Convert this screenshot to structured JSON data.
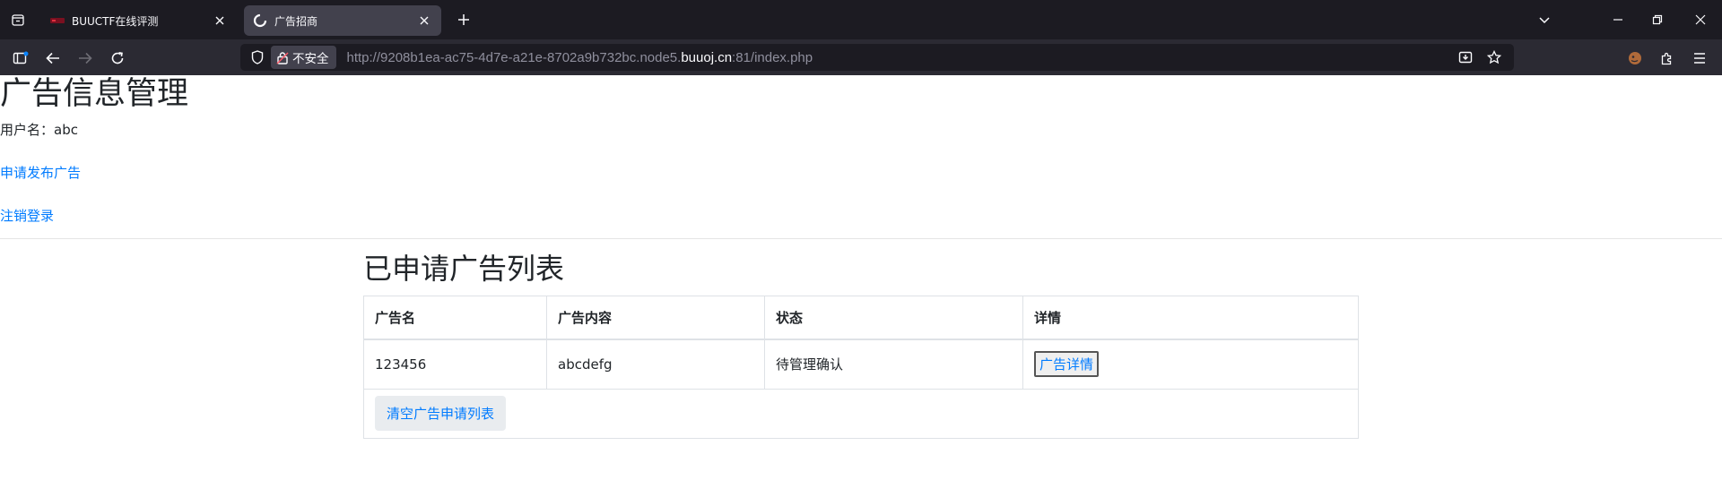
{
  "browser": {
    "tabs": [
      {
        "title": "BUUCTF在线评测",
        "active": false,
        "favicon": "buuctf-logo-icon"
      },
      {
        "title": "广告招商",
        "active": true,
        "favicon": "loading-icon"
      }
    ],
    "security_label": "不安全",
    "url_prefix": "http://9208b1ea-ac75-4d7e-a21e-8702a9b732bc.node5.",
    "url_host": "buuoj.cn",
    "url_suffix": ":81/index.php",
    "accent": "#1c1b22"
  },
  "page": {
    "title": "广告信息管理",
    "username_label": "用户名：",
    "username": "abc",
    "apply_link": "申请发布广告",
    "logout_link": "注销登录",
    "list_title": "已申请广告列表",
    "table": {
      "headers": [
        "广告名",
        "广告内容",
        "状态",
        "详情"
      ],
      "rows": [
        {
          "name": "123456",
          "content": "abcdefg",
          "status": "待管理确认",
          "detail_button": "广告详情"
        }
      ]
    },
    "clear_button": "清空广告申请列表",
    "link_color": "#007bff"
  }
}
